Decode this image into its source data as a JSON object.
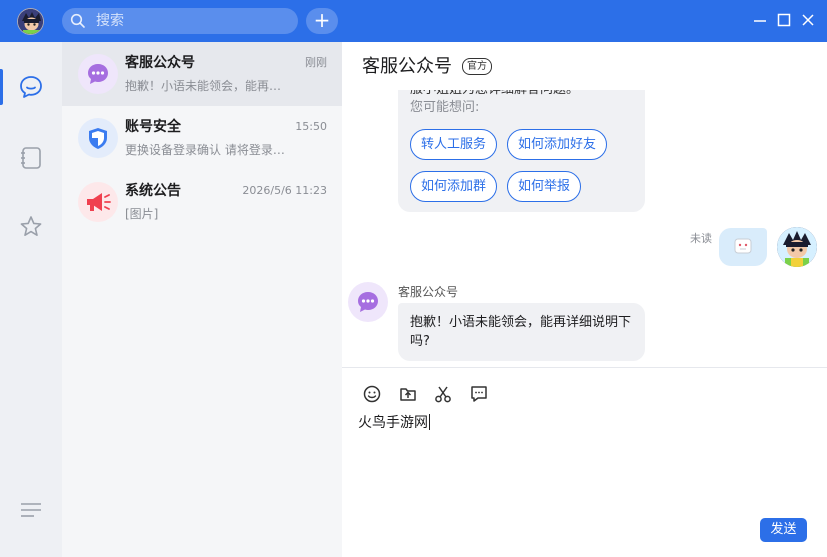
{
  "topbar": {
    "search_placeholder": "搜索",
    "add_symbol": "+"
  },
  "conversations": [
    {
      "name": "客服公众号",
      "time": "刚刚",
      "preview": "抱歉！小语未能领会，能再…"
    },
    {
      "name": "账号安全",
      "time": "15:50",
      "preview": "更换设备登录确认 请将登录…"
    },
    {
      "name": "系统公告",
      "time": "2026/5/6 11:23",
      "preview": "[图片]"
    }
  ],
  "chat": {
    "title": "客服公众号",
    "badge": "官方",
    "partial_line": "服小姐姐为您详细解答问题。",
    "hint": "您可能想问:",
    "quick_replies": [
      "转人工服务",
      "如何添加好友",
      "如何添加群",
      "如何举报"
    ],
    "unread_label": "未读",
    "bot_name": "客服公众号",
    "bot_message": "抱歉！小语未能领会，能再详细说明下吗?",
    "input_value": "火鸟手游网",
    "send_label": "发送"
  },
  "colors": {
    "accent": "#2c6fe8",
    "sidebar_bg": "#eef0f4",
    "list_bg": "#f5f6f8",
    "bubble_bg": "#f0f1f4",
    "self_bubble_bg": "#d9ecfb"
  },
  "icons": {
    "titlebar": [
      "search-icon",
      "plus-icon",
      "minimize-icon",
      "maximize-icon",
      "close-icon"
    ],
    "rail": [
      "chat-icon",
      "contacts-book-icon",
      "star-icon",
      "menu-icon"
    ],
    "toolbar": [
      "emoji-icon",
      "upload-file-icon",
      "scissors-icon",
      "quick-reply-icon"
    ]
  }
}
